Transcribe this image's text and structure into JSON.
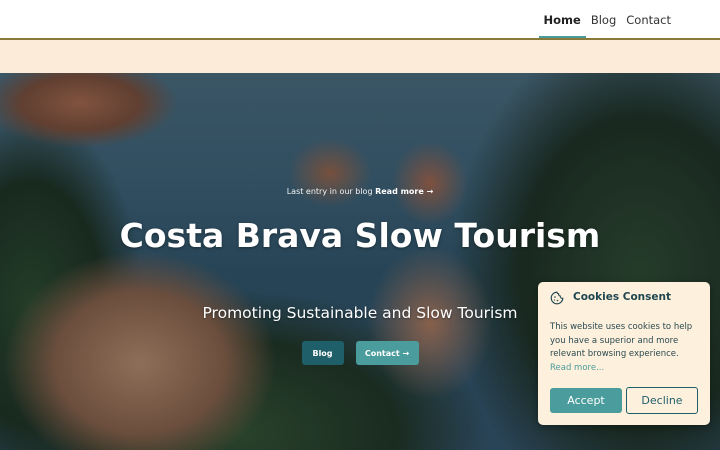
{
  "nav": {
    "items": [
      {
        "label": "Home",
        "active": true
      },
      {
        "label": "Blog",
        "active": false
      },
      {
        "label": "Contact",
        "active": false
      }
    ]
  },
  "hero": {
    "last_entry_prefix": "Last entry in our blog ",
    "last_entry_link": "Read more →",
    "title": "Costa Brava Slow Tourism",
    "subtitle": "Promoting Sustainable and Slow Tourism",
    "blog_button": "Blog",
    "contact_button": "Contact →"
  },
  "cookie": {
    "icon": "cookie-icon",
    "title": "Cookies Consent",
    "text": "This website uses cookies to help you have a superior and more relevant browsing experience. ",
    "read_more": "Read more...",
    "accept": "Accept",
    "decline": "Decline"
  },
  "colors": {
    "accent": "#4a9d9c",
    "dark_teal": "#1f5f6a",
    "banner": "#fbebd8",
    "cookie_bg": "#fdf0dc"
  }
}
